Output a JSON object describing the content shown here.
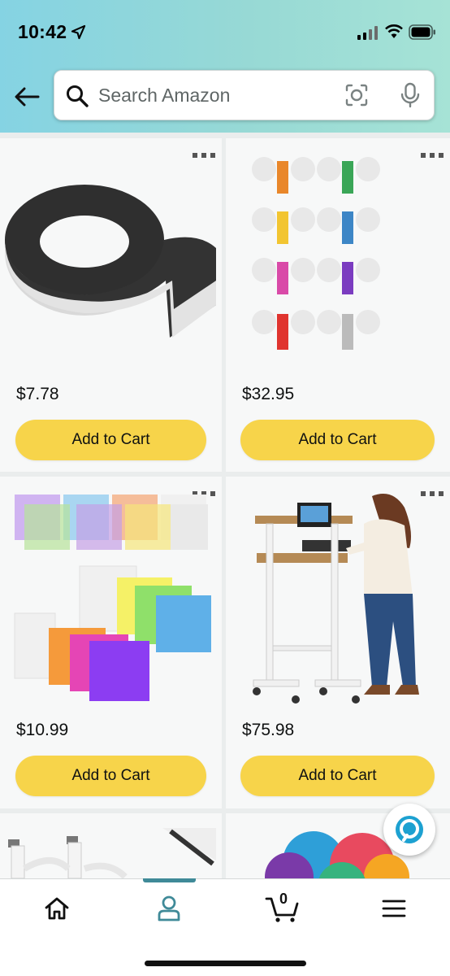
{
  "status_bar": {
    "time": "10:42"
  },
  "search": {
    "placeholder": "Search Amazon"
  },
  "products": [
    {
      "name": "magnetic tape roll",
      "price": "$7.78",
      "button": "Add to Cart"
    },
    {
      "name": "colorful earbuds 8 pack",
      "price": "$32.95",
      "button": "Add to Cart"
    },
    {
      "name": "colored plastic sheets",
      "price": "$10.99",
      "button": "Add to Cart"
    },
    {
      "name": "standing desk cart",
      "price": "$75.98",
      "button": "Add to Cart"
    },
    {
      "name": "white extension cords",
      "price": "",
      "button": ""
    },
    {
      "name": "floor sitting spots",
      "price": "",
      "button": ""
    }
  ],
  "nav": {
    "items": [
      "home-icon",
      "account-icon",
      "cart-icon",
      "menu-icon"
    ],
    "cart_count": "0",
    "active": "account"
  },
  "colors": {
    "accent": "#3f8a98",
    "add_to_cart": "#f7d44a",
    "header_gradient_start": "#85d3e3",
    "header_gradient_end": "#a6e3d6"
  }
}
